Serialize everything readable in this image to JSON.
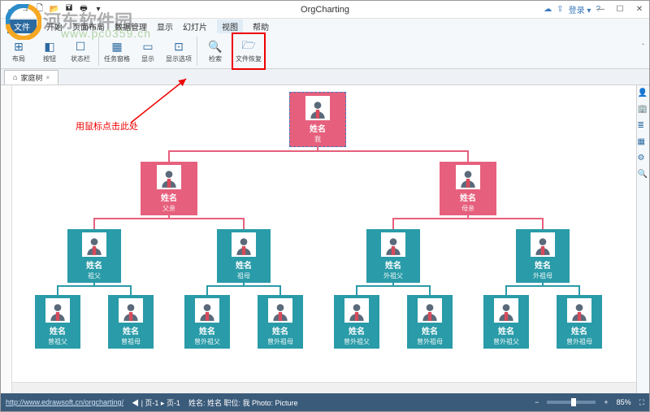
{
  "app": {
    "title": "OrgCharting"
  },
  "qat": [
    "←",
    "→",
    "🗋",
    "📂",
    "🖬",
    "🖶",
    "▾"
  ],
  "win": {
    "min": "—",
    "max": "☐",
    "close": "✕"
  },
  "topright": {
    "cloud": "☁",
    "share": "⇪",
    "login": "登录 ▾",
    "help": "?"
  },
  "menu": {
    "file": "文件",
    "items": [
      "开始",
      "页面布局",
      "数据管理",
      "显示",
      "幻灯片",
      "视图",
      "帮助"
    ]
  },
  "ribbon": [
    {
      "icon": "⊞",
      "label": "布局"
    },
    {
      "icon": "◧",
      "label": "按钮"
    },
    {
      "icon": "☐",
      "label": "状态栏"
    },
    {
      "icon": "▦",
      "label": "任务窗格"
    },
    {
      "icon": "▭",
      "label": "显示"
    },
    {
      "icon": "⊡",
      "label": "显示选项"
    },
    {
      "icon": "🔍",
      "label": "检索"
    },
    {
      "icon": "🗁",
      "label": "文件恢复"
    }
  ],
  "doc_tab": {
    "icon": "⌂",
    "label": "家庭树",
    "close": "×"
  },
  "rside": [
    "👤",
    "🏢",
    "≣",
    "▦",
    "⚙",
    "🔍"
  ],
  "annotation": "用鼠标点击此处",
  "chart_data": {
    "type": "tree",
    "root": {
      "name": "姓名",
      "role": "我",
      "color": "pink",
      "children": [
        {
          "name": "姓名",
          "role": "父亲",
          "color": "pink",
          "children": [
            {
              "name": "姓名",
              "role": "祖父",
              "color": "teal",
              "children": [
                {
                  "name": "姓名",
                  "role": "曾祖父",
                  "color": "teal"
                },
                {
                  "name": "姓名",
                  "role": "曾祖母",
                  "color": "teal"
                }
              ]
            },
            {
              "name": "姓名",
              "role": "祖母",
              "color": "teal",
              "children": [
                {
                  "name": "姓名",
                  "role": "曾外祖父",
                  "color": "teal"
                },
                {
                  "name": "姓名",
                  "role": "曾外祖母",
                  "color": "teal"
                }
              ]
            }
          ]
        },
        {
          "name": "姓名",
          "role": "母亲",
          "color": "pink",
          "children": [
            {
              "name": "姓名",
              "role": "外祖父",
              "color": "teal",
              "children": [
                {
                  "name": "姓名",
                  "role": "曾外祖父",
                  "color": "teal"
                },
                {
                  "name": "姓名",
                  "role": "曾外祖母",
                  "color": "teal"
                }
              ]
            },
            {
              "name": "姓名",
              "role": "外祖母",
              "color": "teal",
              "children": [
                {
                  "name": "姓名",
                  "role": "曾外祖父",
                  "color": "teal"
                },
                {
                  "name": "姓名",
                  "role": "曾外祖母",
                  "color": "teal"
                }
              ]
            }
          ]
        }
      ]
    }
  },
  "status": {
    "url": "http://www.edrawsoft.cn/orgcharting/",
    "page_nav": "◀ | 页-1 ▸ 页-1",
    "sel": "姓名: 姓名  职位: 我  Photo: Picture",
    "zoom_out": "−",
    "zoom_in": "+",
    "zoom": "85%",
    "fit": "⛶"
  },
  "watermark": {
    "text": "河东软件园",
    "url": "www.pc0359.cn"
  }
}
